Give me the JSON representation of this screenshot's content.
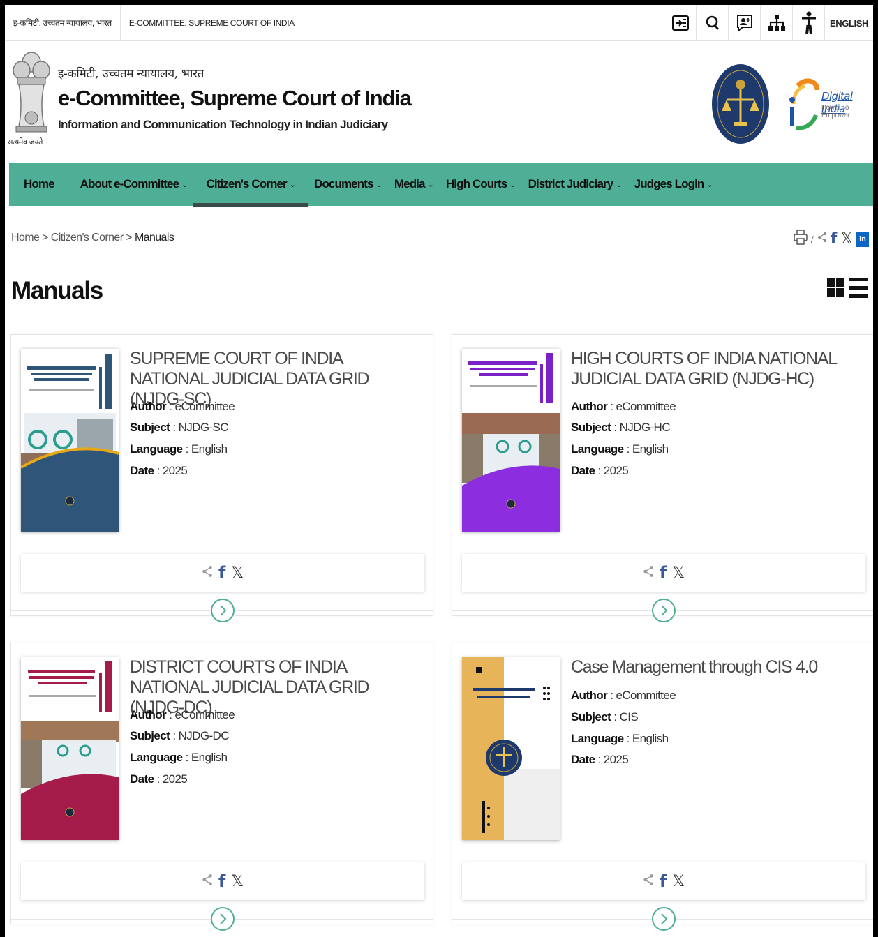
{
  "topbar": {
    "hindi_label": "इ-कमिटी, उच्चतम न्यायालय, भारत",
    "english_label": "E-COMMITTEE, SUPREME COURT OF INDIA",
    "language": "ENGLISH",
    "icons": [
      "skip-to-content-icon",
      "search-icon",
      "feedback-icon",
      "sitemap-icon",
      "accessibility-icon"
    ]
  },
  "header": {
    "emblem_caption": "सत्यमेव जयते",
    "title_hindi": "इ-कमिटी, उच्चतम न्यायालय, भारत",
    "title": "e-Committee, Supreme Court of India",
    "subtitle": "Information and Communication Technology in Indian Judiciary",
    "digital_india": "Digital India",
    "digital_india_tagline": "Power To Empower"
  },
  "nav": {
    "items": [
      {
        "label": "Home",
        "dropdown": false
      },
      {
        "label": "About e-Committee",
        "dropdown": true
      },
      {
        "label": "Citizen's Corner",
        "dropdown": true,
        "active": true
      },
      {
        "label": "Documents",
        "dropdown": true
      },
      {
        "label": "Media",
        "dropdown": true
      },
      {
        "label": "High Courts",
        "dropdown": true
      },
      {
        "label": "District Judiciary",
        "dropdown": true
      },
      {
        "label": "Judges Login",
        "dropdown": true
      }
    ]
  },
  "breadcrumb": {
    "home": "Home",
    "sep": ">",
    "parent": "Citizen's Corner",
    "current": "Manuals"
  },
  "page": {
    "title": "Manuals"
  },
  "labels": {
    "author": "Author",
    "subject": "Subject",
    "language": "Language",
    "date": "Date"
  },
  "manuals": [
    {
      "title": "SUPREME COURT OF INDIA NATIONAL JUDICIAL DATA GRID (NJDG-SC)",
      "author": "eCommittee",
      "subject": "NJDG-SC",
      "language": "English",
      "date": "2025",
      "cover_color": "#2f5578",
      "cover_accent": "#2f5578"
    },
    {
      "title": "HIGH COURTS OF INDIA NATIONAL JUDICIAL DATA GRID (NJDG-HC)",
      "author": "eCommittee",
      "subject": "NJDG-HC",
      "language": "English",
      "date": "2025",
      "cover_color": "#7a22c8",
      "cover_accent": "#7a22c8"
    },
    {
      "title": "DISTRICT COURTS OF INDIA NATIONAL JUDICIAL DATA GRID (NJDG-DC)",
      "author": "eCommittee",
      "subject": "NJDG-DC",
      "language": "English",
      "date": "2025",
      "cover_color": "#a51c4a",
      "cover_accent": "#a51c4a"
    },
    {
      "title": "Case Management through CIS 4.0",
      "author": "eCommittee",
      "subject": "CIS",
      "language": "English",
      "date": "2025",
      "cover_color": "#e8b45a",
      "cover_accent": "#1e3a6d"
    }
  ],
  "colors": {
    "nav_bg": "#4fae96",
    "accent": "#4fae96",
    "facebook": "#3b5998",
    "linkedin": "#0a66c2"
  }
}
